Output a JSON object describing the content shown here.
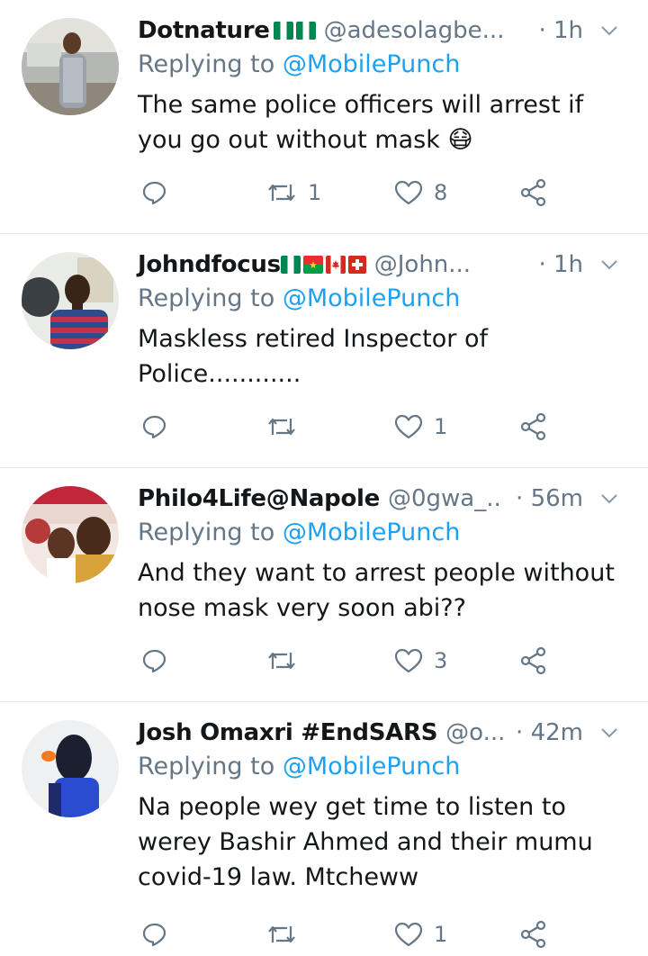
{
  "tweets": [
    {
      "name": "Dotnature",
      "flags": [
        "nigeria",
        "nigeria"
      ],
      "handle": "@adesolagbe...",
      "time": "· 1h",
      "replying_prefix": "Replying to ",
      "replying_to": "@MobilePunch",
      "text": "The same police officers will arrest if you go out without mask 😷",
      "retweets": "1",
      "likes": "8"
    },
    {
      "name": "Johndfocus",
      "flags": [
        "nigeria",
        "burkina-faso",
        "canada",
        "switzerland"
      ],
      "handle": "@John...",
      "time": "· 1h",
      "replying_prefix": "Replying to ",
      "replying_to": "@MobilePunch",
      "text": "Maskless retired Inspector of Police............",
      "retweets": "",
      "likes": "1"
    },
    {
      "name": "Philo4Life@Napole",
      "flags": [],
      "handle": "@0gwa_...",
      "time": "· 56m",
      "replying_prefix": "Replying to ",
      "replying_to": "@MobilePunch",
      "text": "And they want to arrest people without nose mask very soon abi??",
      "retweets": "",
      "likes": "3"
    },
    {
      "name": "Josh Omaxri #EndSARS",
      "flags": [],
      "handle": "@o...",
      "time": "· 42m",
      "replying_prefix": "Replying to ",
      "replying_to": "@MobilePunch",
      "text": "Na people wey get time to listen to werey Bashir Ahmed and their mumu covid-19 law. Mtcheww",
      "retweets": "",
      "likes": "1"
    }
  ],
  "colors": {
    "accent": "#1da1f2",
    "secondary_text": "#657786",
    "primary_text": "#14171a",
    "divider": "#e1e8ed"
  },
  "icons": [
    "reply-icon",
    "retweet-icon",
    "like-icon",
    "share-icon",
    "chevron-down-icon"
  ]
}
